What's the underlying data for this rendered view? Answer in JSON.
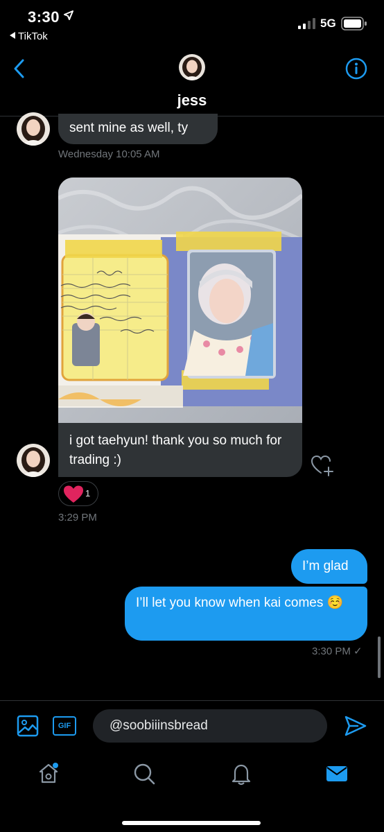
{
  "status": {
    "time": "3:30",
    "back_app": "TikTok",
    "network": "5G"
  },
  "header": {
    "name": "jess"
  },
  "messages": {
    "m1": {
      "text": "sent mine as well, ty",
      "meta": "Wednesday 10:05 AM"
    },
    "m2": {
      "text": "i got taehyun! thank you so much for trading :)",
      "reaction_count": "1",
      "meta": "3:29 PM"
    },
    "m3": {
      "text": "I’m glad"
    },
    "m4": {
      "text": "I’ll let you know when kai comes ☺️",
      "meta": "3:30 PM ✓"
    }
  },
  "composer": {
    "input_value": "@soobiiinsbread",
    "gif_label": "GIF"
  },
  "icons": {
    "back": "chevron-left-icon",
    "info": "info-icon",
    "image": "image-icon",
    "send": "send-icon",
    "home": "home-icon",
    "search": "search-icon",
    "notifications": "bell-icon",
    "messages": "mail-icon"
  },
  "colors": {
    "accent": "#1d9bf0",
    "incoming_bubble": "#2f3336",
    "background": "#000000",
    "muted_text": "#71767b",
    "reaction_heart": "#f91880"
  }
}
